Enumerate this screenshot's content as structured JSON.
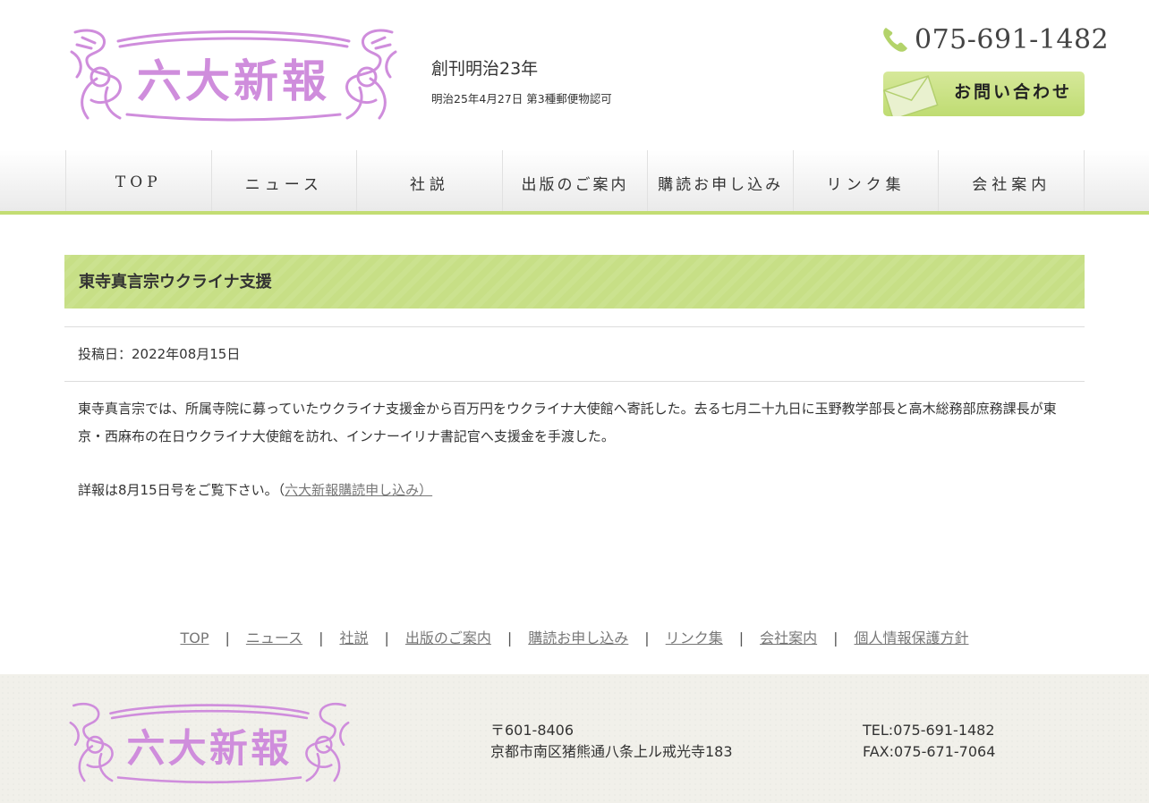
{
  "header": {
    "logo_text": "六大新報",
    "tagline": "創刊明治23年",
    "permit": "明治25年4月27日 第3種郵便物認可",
    "phone": "075-691-1482",
    "contact_label": "お問い合わせ"
  },
  "nav": {
    "items": [
      "TOP",
      "ニュース",
      "社説",
      "出版のご案内",
      "購読お申し込み",
      "リンク集",
      "会社案内"
    ]
  },
  "article": {
    "title": "東寺真言宗ウクライナ支援",
    "date": "投稿日：2022年08月15日",
    "body": "東寺真言宗では、所属寺院に募っていたウクライナ支援金から百万円をウクライナ大使館へ寄託した。去る七月二十九日に玉野教学部長と高木総務部庶務課長が東京・西麻布の在日ウクライナ大使館を訪れ、インナーイリナ書記官へ支援金を手渡した。",
    "detail_prefix": "詳報は8月15日号をご覧下さい。（",
    "detail_link": "六大新報購読申し込み）"
  },
  "footer_links": [
    "TOP",
    "ニュース",
    "社説",
    "出版のご案内",
    "購読お申し込み",
    "リンク集",
    "会社案内",
    "個人情報保護方針"
  ],
  "footer": {
    "postal": "〒601-8406",
    "address": "京都市南区猪熊通八条上ル戒光寺183",
    "tel": "TEL:075-691-1482",
    "fax": "FAX:075-671-7064"
  },
  "colors": {
    "accent_green": "#c3dd73",
    "logo_purple": "#cf8ddc"
  }
}
